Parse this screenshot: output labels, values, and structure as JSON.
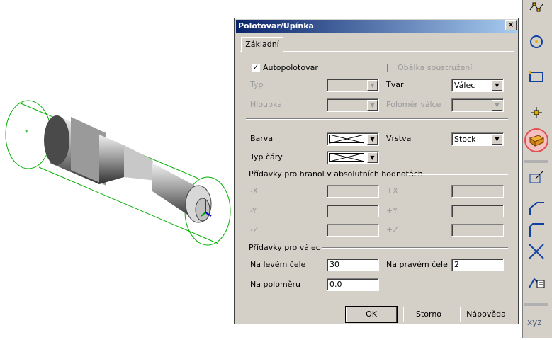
{
  "dialog": {
    "title": "Polotovar/Upínka",
    "close_label": "×",
    "tab_label": "Základní",
    "autopolotovar_label": "Autopolotovar",
    "autopolotovar_checked": true,
    "obalka_label": "Obálka soustružení",
    "obalka_checked": false,
    "typ_label": "Typ",
    "hloubka_label": "Hloubka",
    "tvar_label": "Tvar",
    "tvar_value": "Válec",
    "polomer_label": "Poloměr válce",
    "barva_label": "Barva",
    "typ_cary_label": "Typ čáry",
    "vrstva_label": "Vrstva",
    "vrstva_value": "Stock",
    "hranol_group_label": "Přídavky pro hranol v absolutních hodnotách",
    "minus_x": "-X",
    "minus_y": "-Y",
    "minus_z": "-Z",
    "plus_x": "+X",
    "plus_y": "+Y",
    "plus_z": "+Z",
    "valec_group_label": "Přídavky pro válec",
    "levem_cele_label": "Na levém čele",
    "levem_cele_value": "30",
    "pravem_cele_label": "Na pravém čele",
    "pravem_cele_value": "2",
    "polomeru_label": "Na poloměru",
    "polomeru_value": "0.0",
    "ok_label": "OK",
    "cancel_label": "Storno",
    "help_label": "Nápověda"
  },
  "toolbar": {
    "xyz_label": "xyz"
  },
  "colors": {
    "wireframe": "#00b000",
    "highlight": "#e05050",
    "title_bar": "#0a246a"
  }
}
